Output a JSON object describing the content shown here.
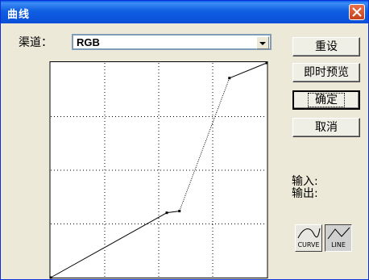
{
  "window": {
    "title": "曲线"
  },
  "channel": {
    "label": "渠道：",
    "value": "RGB"
  },
  "buttons": {
    "reset": "重设",
    "preview": "即时预览",
    "ok": "确定",
    "cancel": "取消"
  },
  "io": {
    "input_label": "输入:",
    "output_label": "输出:"
  },
  "modes": {
    "curve": "CURVE",
    "line": "LINE"
  },
  "curve_points": [
    {
      "input": 0,
      "output": 0
    },
    {
      "input": 137,
      "output": 77
    },
    {
      "input": 152,
      "output": 79
    },
    {
      "input": 211,
      "output": 237
    },
    {
      "input": 255,
      "output": 255
    }
  ],
  "icons": {
    "close": "close-icon",
    "dropdown": "chevron-down-icon",
    "curve": "curve-icon",
    "line": "line-icon"
  }
}
